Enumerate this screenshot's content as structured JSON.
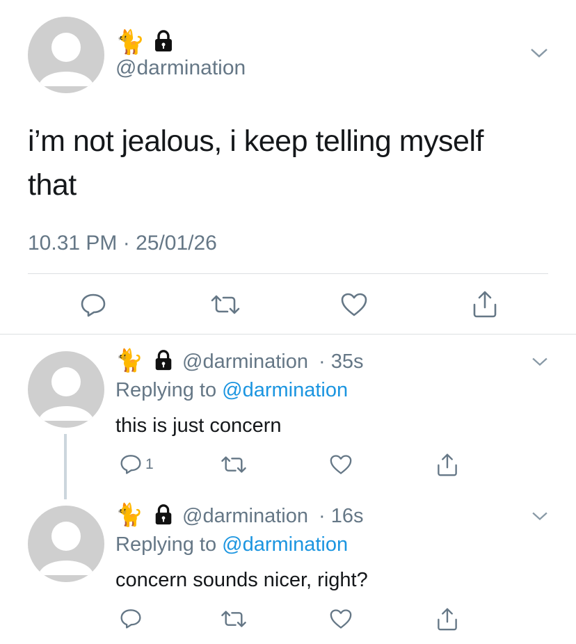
{
  "main_tweet": {
    "name_icons": [
      "cat-icon",
      "lock-icon"
    ],
    "handle": "@darmination",
    "text": "i’m not jealous, i keep telling myself that",
    "timestamp": "10.31 PM · 25/01/26"
  },
  "replies": [
    {
      "name_icons": [
        "cat-icon",
        "lock-icon"
      ],
      "handle": "@darmination",
      "time": "· 35s",
      "replying_prefix": "Replying to",
      "replying_to": "@darmination",
      "text": "this is just concern",
      "reply_count": "1"
    },
    {
      "name_icons": [
        "cat-icon",
        "lock-icon"
      ],
      "handle": "@darmination",
      "time": "· 16s",
      "replying_prefix": "Replying to",
      "replying_to": "@darmination",
      "text": "concern sounds nicer, right?",
      "reply_count": ""
    }
  ],
  "colors": {
    "link": "#1b95e0",
    "muted": "#657786",
    "text": "#14171a",
    "divider": "#dcdfe2"
  }
}
